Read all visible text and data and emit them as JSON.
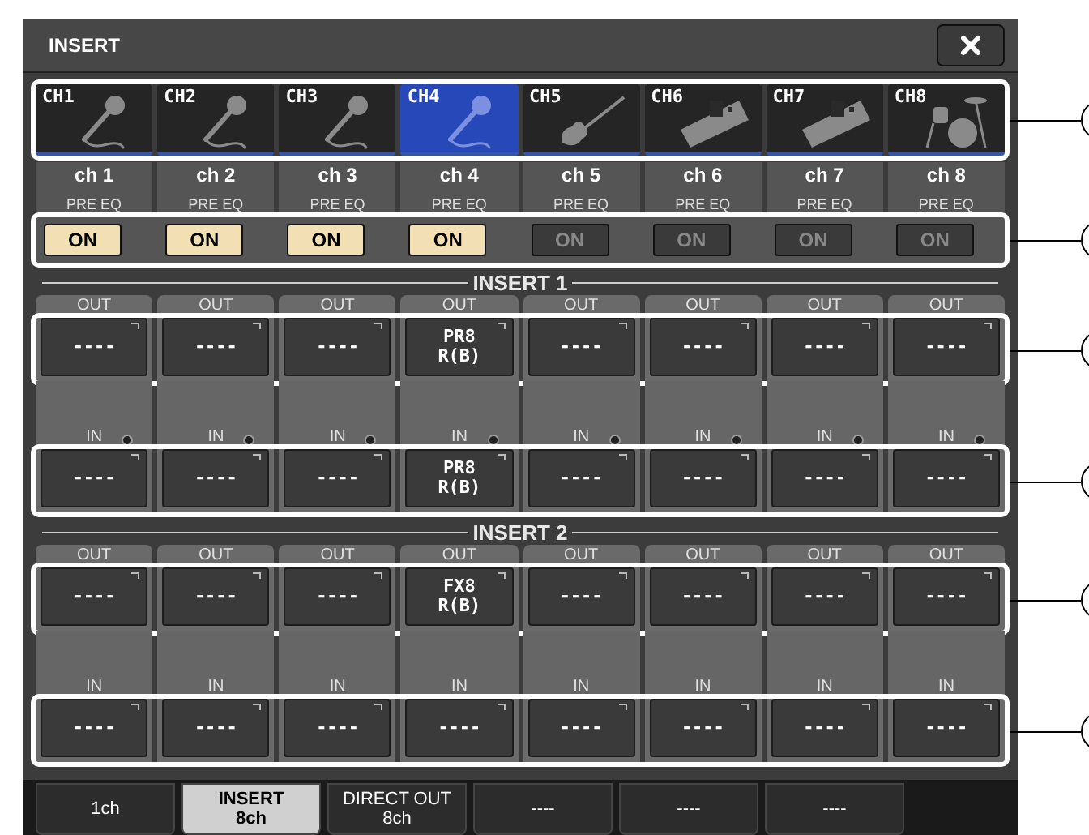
{
  "window": {
    "title": "INSERT"
  },
  "channels": [
    {
      "label": "CH1",
      "kind": "mic",
      "selected": false,
      "name": "ch 1",
      "pre_eq_label": "PRE EQ",
      "pre_eq_button": "ON",
      "pre_eq_on": true
    },
    {
      "label": "CH2",
      "kind": "mic",
      "selected": false,
      "name": "ch 2",
      "pre_eq_label": "PRE EQ",
      "pre_eq_button": "ON",
      "pre_eq_on": true
    },
    {
      "label": "CH3",
      "kind": "mic",
      "selected": false,
      "name": "ch 3",
      "pre_eq_label": "PRE EQ",
      "pre_eq_button": "ON",
      "pre_eq_on": true
    },
    {
      "label": "CH4",
      "kind": "mic",
      "selected": true,
      "name": "ch 4",
      "pre_eq_label": "PRE EQ",
      "pre_eq_button": "ON",
      "pre_eq_on": true
    },
    {
      "label": "CH5",
      "kind": "guitar",
      "selected": false,
      "name": "ch 5",
      "pre_eq_label": "PRE EQ",
      "pre_eq_button": "ON",
      "pre_eq_on": false
    },
    {
      "label": "CH6",
      "kind": "keyboard",
      "selected": false,
      "name": "ch 6",
      "pre_eq_label": "PRE EQ",
      "pre_eq_button": "ON",
      "pre_eq_on": false
    },
    {
      "label": "CH7",
      "kind": "keyboard",
      "selected": false,
      "name": "ch 7",
      "pre_eq_label": "PRE EQ",
      "pre_eq_button": "ON",
      "pre_eq_on": false
    },
    {
      "label": "CH8",
      "kind": "drums",
      "selected": false,
      "name": "ch 8",
      "pre_eq_label": "PRE EQ",
      "pre_eq_button": "ON",
      "pre_eq_on": false
    }
  ],
  "inserts": [
    {
      "title": "INSERT 1",
      "kind": "lamp",
      "out": [
        {
          "header": "OUT",
          "value": [
            "----"
          ]
        },
        {
          "header": "OUT",
          "value": [
            "----"
          ]
        },
        {
          "header": "OUT",
          "value": [
            "----"
          ]
        },
        {
          "header": "OUT",
          "value": [
            "PR8",
            "R(B)"
          ]
        },
        {
          "header": "OUT",
          "value": [
            "----"
          ]
        },
        {
          "header": "OUT",
          "value": [
            "----"
          ]
        },
        {
          "header": "OUT",
          "value": [
            "----"
          ]
        },
        {
          "header": "OUT",
          "value": [
            "----"
          ]
        }
      ],
      "in": [
        {
          "header": "IN",
          "value": [
            "----"
          ]
        },
        {
          "header": "IN",
          "value": [
            "----"
          ]
        },
        {
          "header": "IN",
          "value": [
            "----"
          ]
        },
        {
          "header": "IN",
          "value": [
            "PR8",
            "R(B)"
          ]
        },
        {
          "header": "IN",
          "value": [
            "----"
          ]
        },
        {
          "header": "IN",
          "value": [
            "----"
          ]
        },
        {
          "header": "IN",
          "value": [
            "----"
          ]
        },
        {
          "header": "IN",
          "value": [
            "----"
          ]
        }
      ]
    },
    {
      "title": "INSERT 2",
      "kind": "plain",
      "out": [
        {
          "header": "OUT",
          "value": [
            "----"
          ]
        },
        {
          "header": "OUT",
          "value": [
            "----"
          ]
        },
        {
          "header": "OUT",
          "value": [
            "----"
          ]
        },
        {
          "header": "OUT",
          "value": [
            "FX8",
            "R(B)"
          ]
        },
        {
          "header": "OUT",
          "value": [
            "----"
          ]
        },
        {
          "header": "OUT",
          "value": [
            "----"
          ]
        },
        {
          "header": "OUT",
          "value": [
            "----"
          ]
        },
        {
          "header": "OUT",
          "value": [
            "----"
          ]
        }
      ],
      "in": [
        {
          "header": "IN",
          "value": [
            "----"
          ]
        },
        {
          "header": "IN",
          "value": [
            "----"
          ]
        },
        {
          "header": "IN",
          "value": [
            "----"
          ]
        },
        {
          "header": "IN",
          "value": [
            "----"
          ]
        },
        {
          "header": "IN",
          "value": [
            "----"
          ]
        },
        {
          "header": "IN",
          "value": [
            "----"
          ]
        },
        {
          "header": "IN",
          "value": [
            "----"
          ]
        },
        {
          "header": "IN",
          "value": [
            "----"
          ]
        }
      ]
    }
  ],
  "tabs": [
    {
      "lines": [
        "1ch"
      ],
      "selected": false
    },
    {
      "lines": [
        "INSERT",
        "8ch"
      ],
      "selected": true
    },
    {
      "lines": [
        "DIRECT OUT",
        "8ch"
      ],
      "selected": false
    },
    {
      "lines": [
        "----"
      ],
      "selected": false
    },
    {
      "lines": [
        "----"
      ],
      "selected": false
    },
    {
      "lines": [
        "----"
      ],
      "selected": false
    }
  ]
}
